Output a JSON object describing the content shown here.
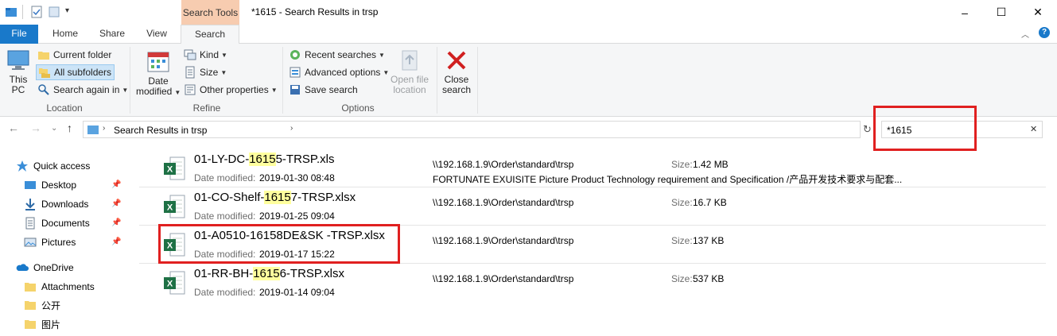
{
  "window": {
    "title": "*1615 - Search Results in trsp",
    "context_tab": "Search Tools",
    "controls": {
      "minimize": "–",
      "maximize": "☐",
      "close": "✕"
    }
  },
  "ribbon_tabs": [
    {
      "label": "File"
    },
    {
      "label": "Home"
    },
    {
      "label": "Share"
    },
    {
      "label": "View"
    },
    {
      "label": "Search"
    }
  ],
  "ribbon": {
    "location": {
      "label": "Location",
      "this_pc_line1": "This",
      "this_pc_line2": "PC",
      "current_folder": "Current folder",
      "all_subfolders": "All subfolders",
      "search_again_in": "Search again in"
    },
    "refine": {
      "label": "Refine",
      "date_line1": "Date",
      "date_line2": "modified",
      "kind": "Kind",
      "size": "Size",
      "other_properties": "Other properties"
    },
    "options": {
      "label": "Options",
      "recent_searches": "Recent searches",
      "advanced_options": "Advanced options",
      "save_search": "Save search",
      "open_file_location_line1": "Open file",
      "open_file_location_line2": "location",
      "close_search_line1": "Close",
      "close_search_line2": "search"
    }
  },
  "address": {
    "path": "Search Results in trsp",
    "search_value": "*1615"
  },
  "nav": {
    "quick_access": "Quick access",
    "desktop": "Desktop",
    "downloads": "Downloads",
    "documents": "Documents",
    "pictures": "Pictures",
    "onedrive": "OneDrive",
    "attachments": "Attachments",
    "gongkai": "公开",
    "tupian": "图片"
  },
  "results": {
    "date_label": "Date modified:",
    "size_label": "Size:",
    "items": [
      {
        "name_pre": "01-LY-DC-",
        "name_hl": "1615",
        "name_post": "5-TRSP.xls",
        "date": "2019-01-30 08:48",
        "path": "\\\\192.168.1.9\\Order\\standard\\trsp",
        "size": "1.42 MB",
        "desc": "FORTUNATE EXUISITE Picture Product Technology requirement and Specification /产品开发技术要求与配套..."
      },
      {
        "name_pre": "01-CO-Shelf-",
        "name_hl": "1615",
        "name_post": "7-TRSP.xlsx",
        "date": "2019-01-25 09:04",
        "path": "\\\\192.168.1.9\\Order\\standard\\trsp",
        "size": "16.7 KB",
        "desc": ""
      },
      {
        "name_pre": "01-A0510-16158DE&SK -TRSP.xlsx",
        "name_hl": "",
        "name_post": "",
        "date": "2019-01-17 15:22",
        "path": "\\\\192.168.1.9\\Order\\standard\\trsp",
        "size": "137 KB",
        "desc": ""
      },
      {
        "name_pre": "01-RR-BH-",
        "name_hl": "1615",
        "name_post": "6-TRSP.xlsx",
        "date": "2019-01-14 09:04",
        "path": "\\\\192.168.1.9\\Order\\standard\\trsp",
        "size": "537 KB",
        "desc": ""
      }
    ]
  },
  "colors": {
    "file_tab": "#1979ca",
    "context_tab": "#f7ccb0",
    "highlight": "#ffff9e",
    "annotation": "#e02020",
    "excel_green": "#1e7145"
  }
}
